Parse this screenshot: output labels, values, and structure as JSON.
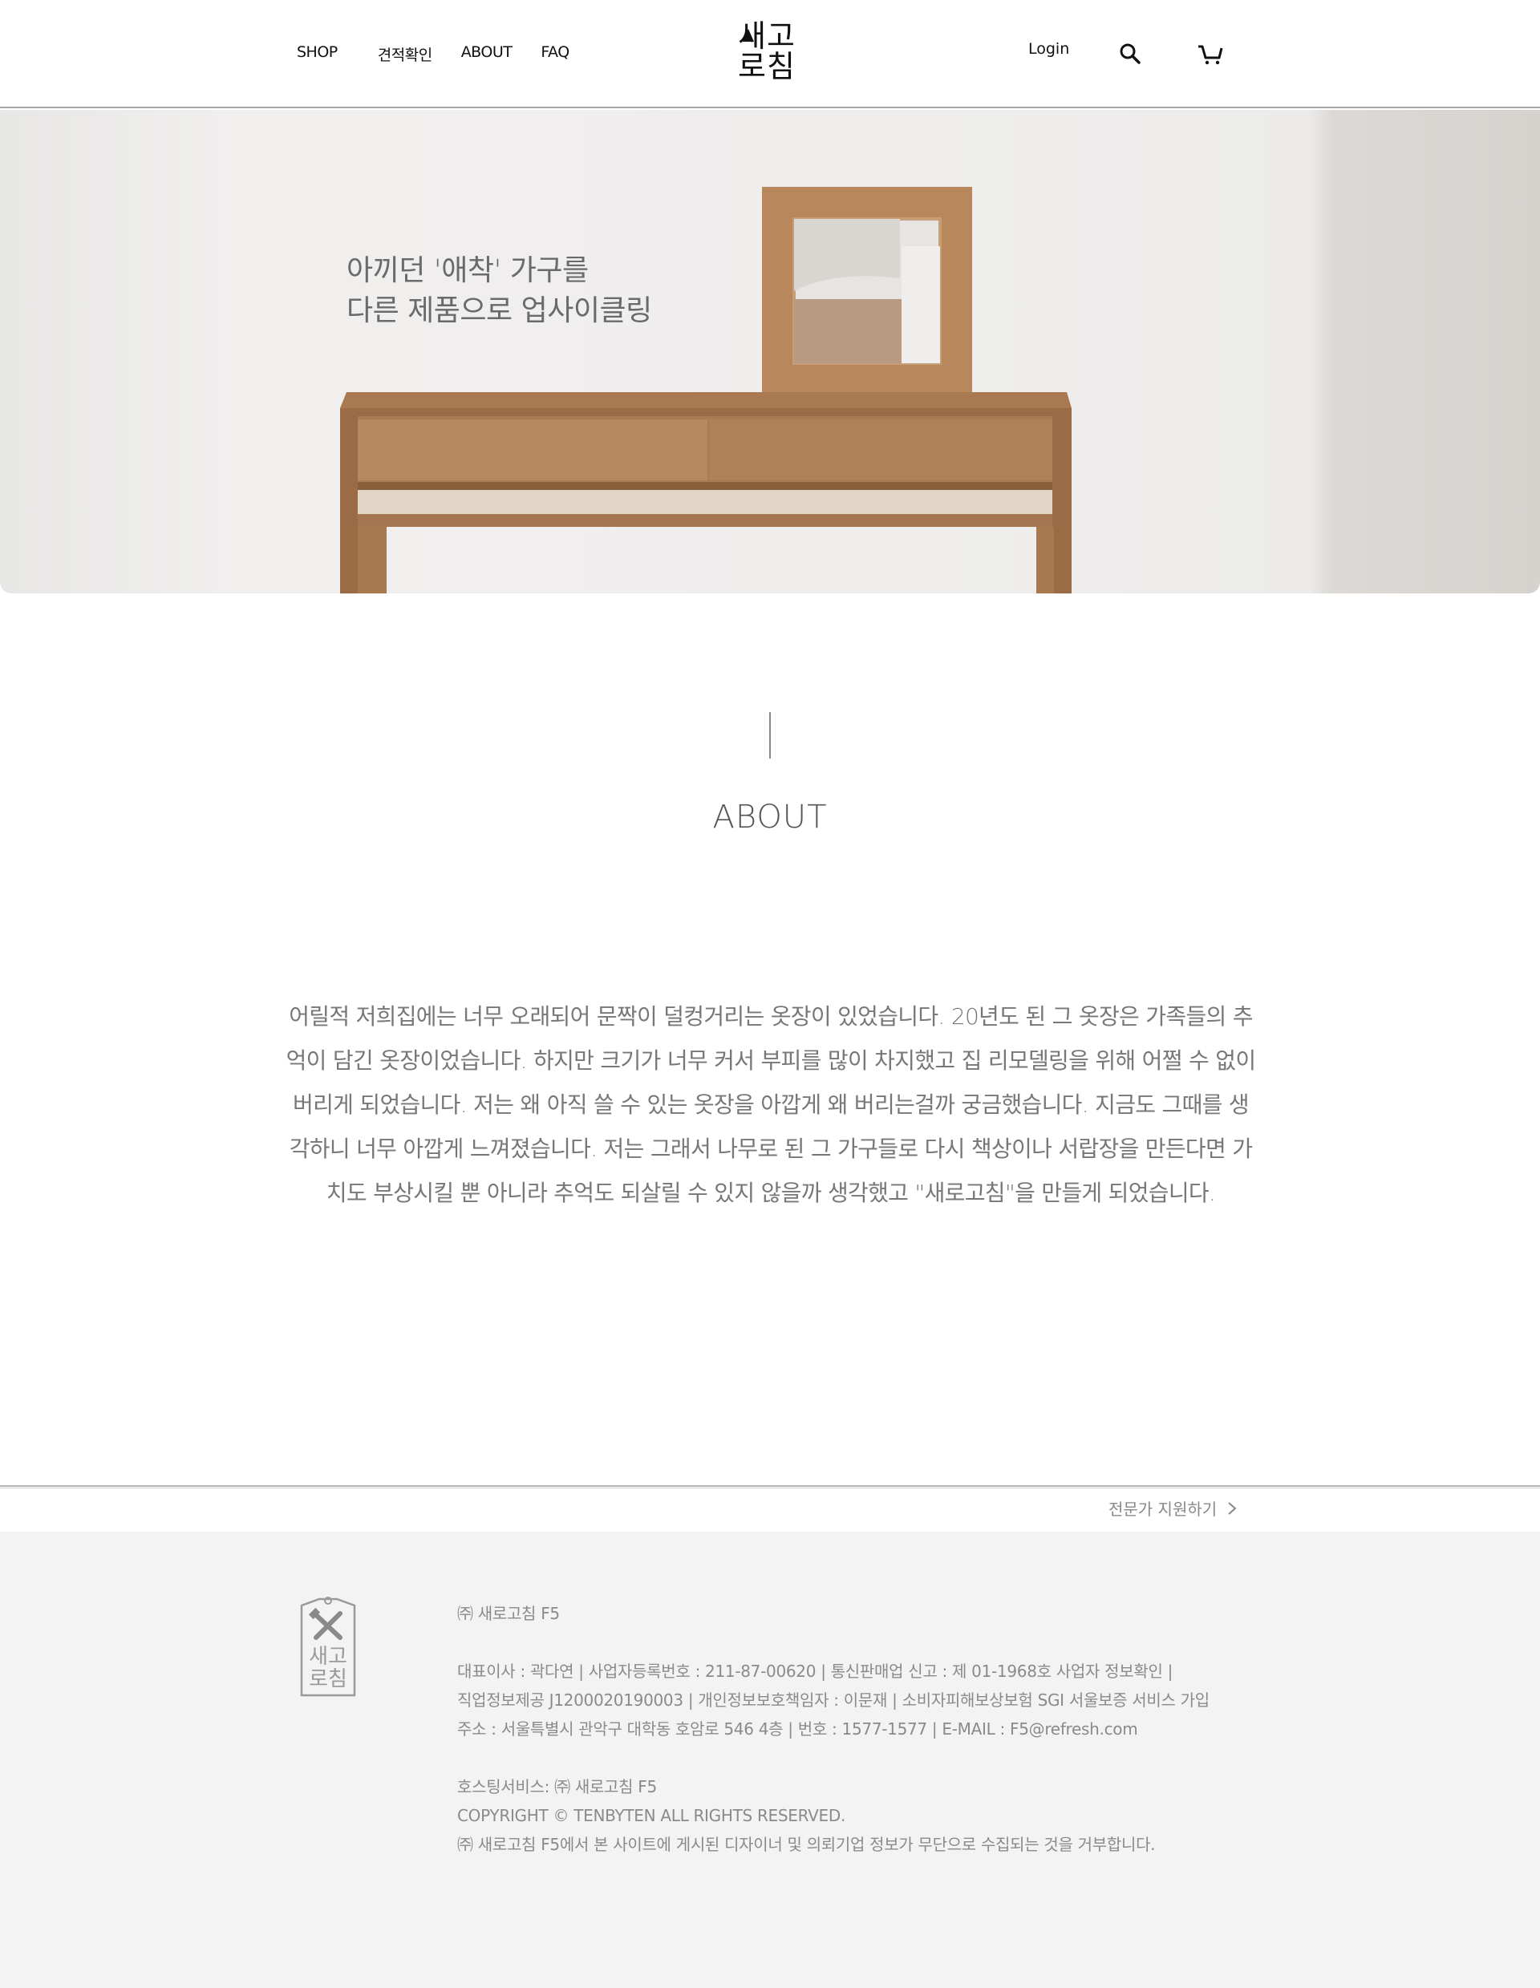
{
  "header": {
    "nav_left": [
      "SHOP",
      "견적확인",
      "ABOUT",
      "FAQ"
    ],
    "logo_line1": "새고",
    "logo_line2": "로침",
    "login": "Login"
  },
  "hero": {
    "line1": "아끼던 '애착' 가구를",
    "line2": "다른 제품으로 업사이클링"
  },
  "about": {
    "title": "ABOUT",
    "body_lines": [
      "어릴적 저희집에는 너무 오래되어 문짝이 덜컹거리는 옷장이 있었습니다. 20년도 된 그 옷장은 가족들의 추",
      "억이 담긴 옷장이었습니다. 하지만 크기가 너무 커서 부피를 많이 차지했고 집 리모델링을 위해 어쩔 수 없이",
      "버리게 되었습니다.  저는 왜 아직 쓸 수 있는 옷장을 아깝게 왜 버리는걸까 궁금했습니다. 지금도 그때를 생",
      "각하니 너무 아깝게 느껴졌습니다. 저는 그래서 나무로 된 그 가구들로 다시 책상이나 서랍장을 만든다면 가",
      "치도 부상시킬 뿐 아니라 추억도 되살릴 수 있지 않을까 생각했고 \"새로고침\"을 만들게 되었습니다."
    ]
  },
  "footer": {
    "expert_link": "전문가 지원하기",
    "logo_line1": "새고",
    "logo_line2": "로침",
    "company": "㈜ 새로고침 F5",
    "info_lines": [
      "대표이사 : 곽다연 | 사업자등록번호 : 211-87-00620 | 통신판매업 신고 : 제 01-1968호 사업자 정보확인 |",
      "직업정보제공 J1200020190003 | 개인정보보호책임자 : 이문재 | 소비자피해보상보험 SGI 서울보증 서비스 가입",
      "주소 : 서울특별시 관악구 대학동 호암로 546 4층 | 번호 : 1577-1577 | E-MAIL : F5@refresh.com"
    ],
    "hosting": "호스팅서비스: ㈜ 새로고침 F5",
    "copyright": "COPYRIGHT © TENBYTEN ALL RIGHTS RESERVED.",
    "notice": "㈜ 새로고침 F5에서 본 사이트에 게시된 디자이너 및 의뢰기업 정보가 무단으로 수집되는 것을 거부합니다."
  }
}
